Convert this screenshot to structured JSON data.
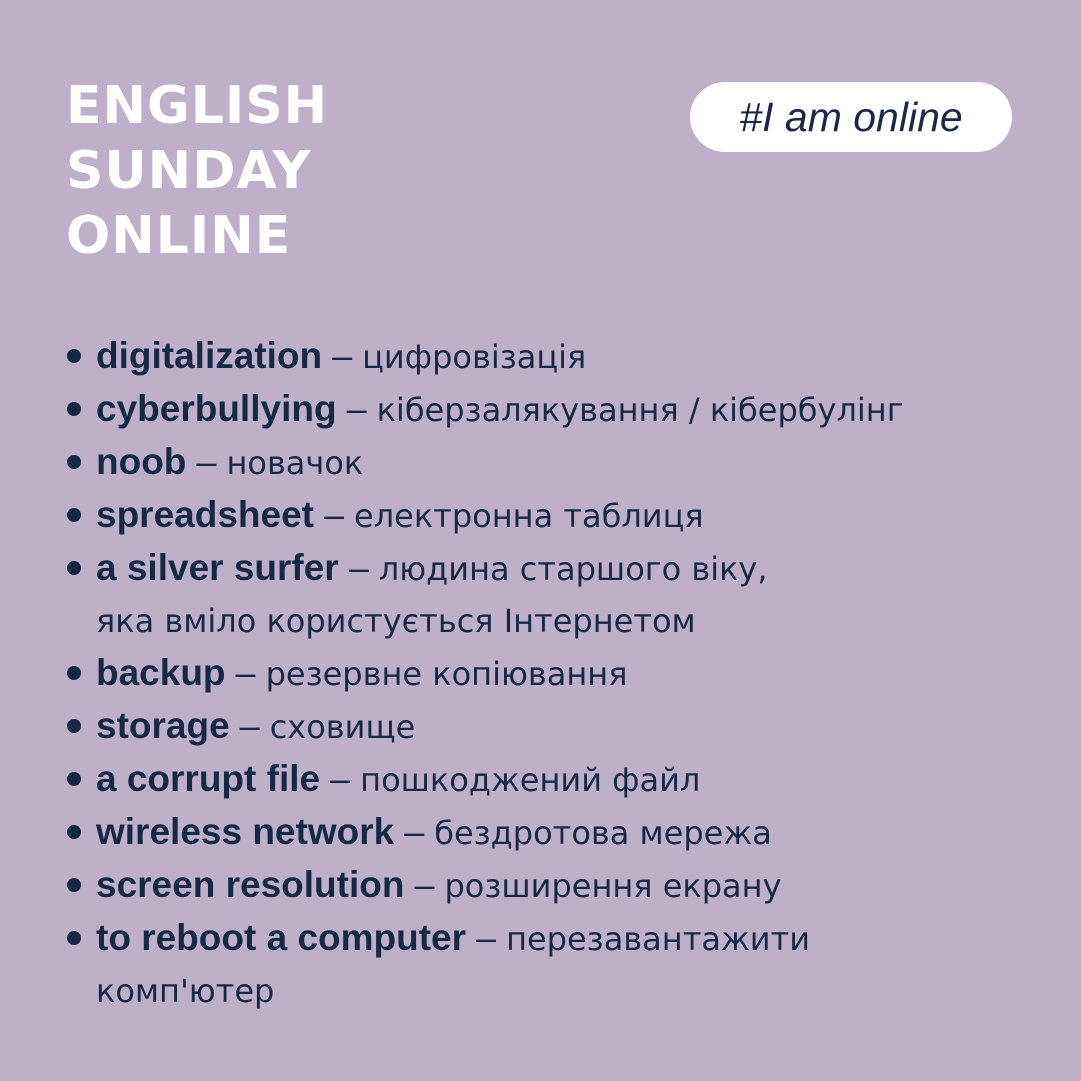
{
  "title": {
    "lines": [
      "ENGLISH",
      "SUNDAY",
      "ONLINE"
    ]
  },
  "hashtag": "#I am online",
  "separator": "–",
  "vocabulary": [
    {
      "term": "digitalization",
      "translation": "цифровізація"
    },
    {
      "term": "cyberbullying",
      "translation": "кіберзалякування / кібербулінг"
    },
    {
      "term": "noob",
      "translation": "новачок"
    },
    {
      "term": "spreadsheet",
      "translation": "електронна таблиця"
    },
    {
      "term": "a silver surfer",
      "translation": "людина старшого віку,",
      "translation_line2": "яка вміло користується Інтернетом"
    },
    {
      "term": "backup",
      "translation": "резервне копіювання"
    },
    {
      "term": "storage",
      "translation": "сховище"
    },
    {
      "term": "a corrupt file",
      "translation": "пошкоджений файл"
    },
    {
      "term": "wireless network",
      "translation": "бездротова мережа"
    },
    {
      "term": "screen resolution",
      "translation": "розширення екрану"
    },
    {
      "term": "to reboot a computer",
      "translation": "перезавантажити",
      "translation_line2": "комп'ютер"
    }
  ],
  "colors": {
    "background": "#bfb0ca",
    "text_dark": "#172746",
    "title": "#ffffff",
    "pill": "#ffffff"
  }
}
